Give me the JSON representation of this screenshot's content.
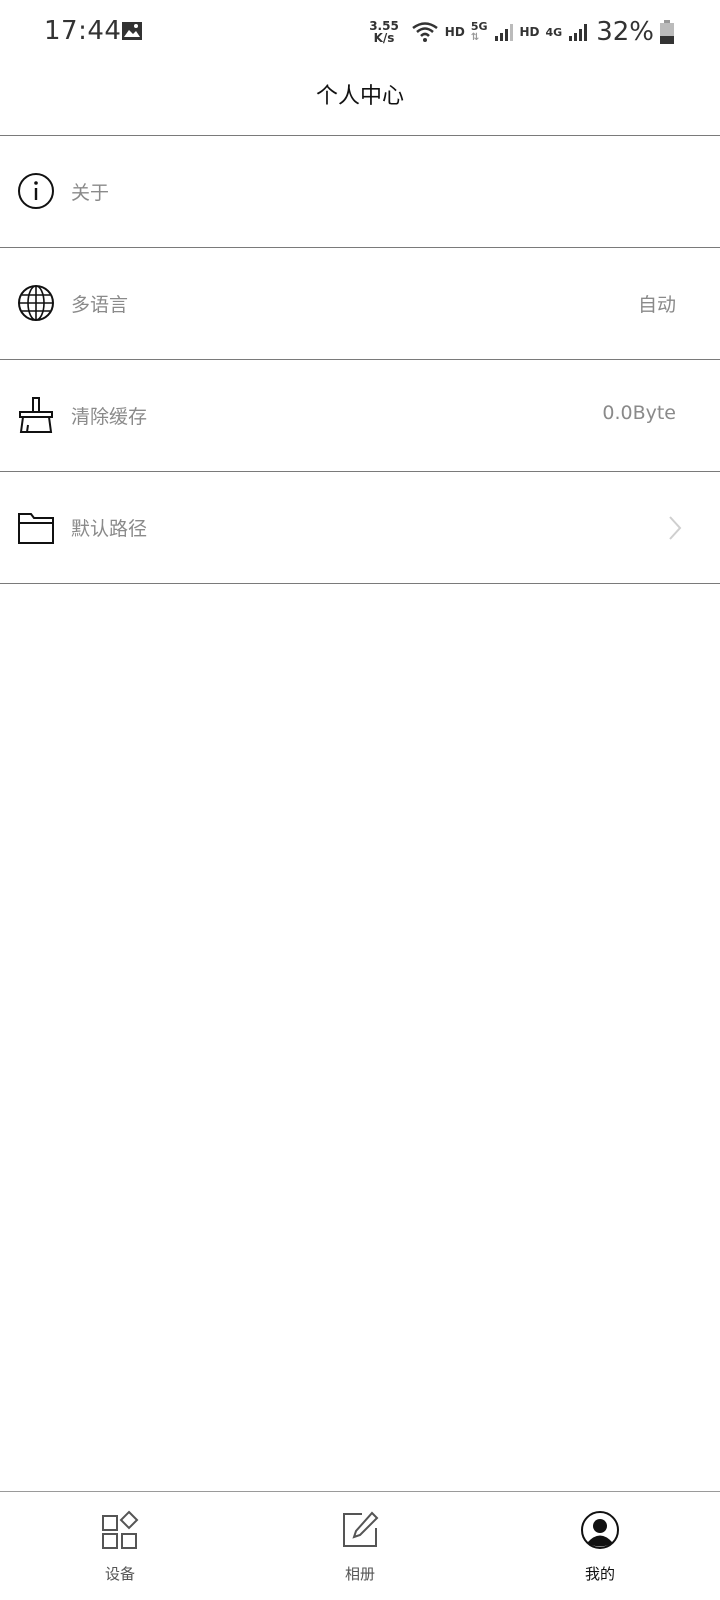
{
  "status_bar": {
    "time": "17:44",
    "speed_value": "3.55",
    "speed_unit": "K/s",
    "hd1": "HD",
    "net1": "5G",
    "hd2": "HD",
    "net2": "4G",
    "battery": "32%",
    "icons": [
      "gallery-icon",
      "wifi-icon",
      "signal-icon",
      "battery-icon"
    ]
  },
  "header": {
    "title": "个人中心"
  },
  "settings": {
    "items": [
      {
        "label": "关于",
        "value": "",
        "icon": "info-icon"
      },
      {
        "label": "多语言",
        "value": "自动",
        "icon": "globe-icon"
      },
      {
        "label": "清除缓存",
        "value": "0.0Byte",
        "icon": "broom-icon"
      },
      {
        "label": "默认路径",
        "value": "",
        "icon": "folder-icon",
        "chevron": true
      }
    ]
  },
  "bottom_nav": {
    "items": [
      {
        "label": "设备",
        "icon": "devices-icon",
        "active": false
      },
      {
        "label": "相册",
        "icon": "edit-icon",
        "active": false
      },
      {
        "label": "我的",
        "icon": "profile-icon",
        "active": true
      }
    ]
  },
  "colors": {
    "divider": "#7a7a7a",
    "label_text": "#8a8a8a",
    "title_text": "#111111"
  }
}
